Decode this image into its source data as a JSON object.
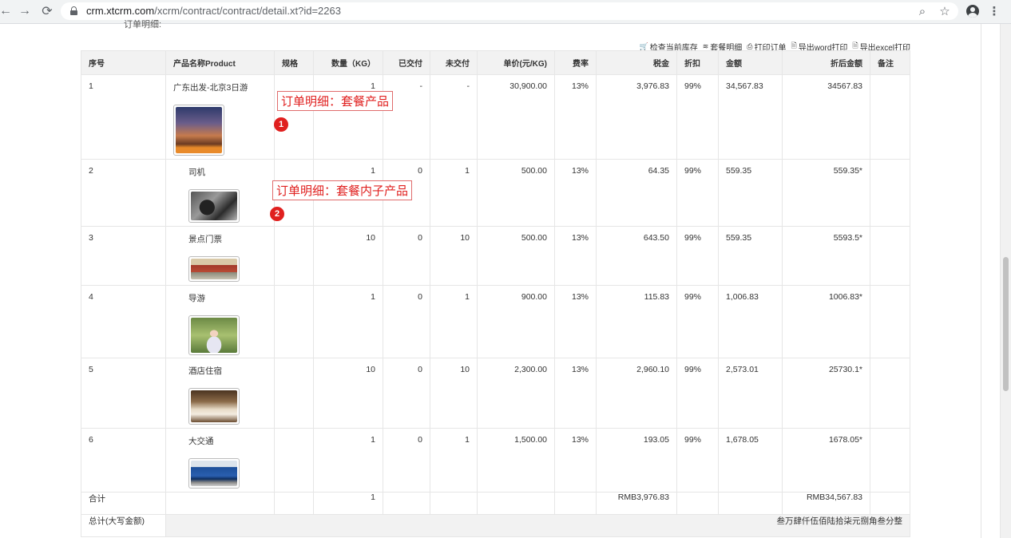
{
  "browser": {
    "url_host": "crm.xtcrm.com",
    "url_path": "/xcrm/contract/contract/detail.xt?id=2263"
  },
  "page": {
    "cut_title": "订单明细:"
  },
  "toolbar": [
    {
      "icon": "cart-icon",
      "glyph": "🛒",
      "label": "检查当前库存"
    },
    {
      "icon": "layers-icon",
      "glyph": "≋",
      "label": "套餐明细"
    },
    {
      "icon": "printer-icon",
      "glyph": "⎙",
      "label": "打印订单"
    },
    {
      "icon": "word-file-icon",
      "glyph": "🗎",
      "label": "导出word打印"
    },
    {
      "icon": "excel-file-icon",
      "glyph": "🗎",
      "label": "导出excel打印"
    }
  ],
  "table": {
    "headers": [
      "序号",
      "产品名称Product",
      "规格",
      "数量（KG）",
      "已交付",
      "未交付",
      "单价(元/KG)",
      "费率",
      "税金",
      "折扣",
      "金额",
      "折后金额",
      "备注"
    ],
    "rows": [
      {
        "no": "1",
        "product": "广东出发-北京3日游",
        "spec": "",
        "qty": "1",
        "delivered": "-",
        "undelivered": "-",
        "price": "30,900.00",
        "rate": "13%",
        "tax": "3,976.83",
        "discount": "99%",
        "amount": "34,567.83",
        "final": "34567.83",
        "note": "",
        "image": "temple",
        "sub": false
      },
      {
        "no": "2",
        "product": "司机",
        "spec": "",
        "qty": "1",
        "delivered": "0",
        "undelivered": "1",
        "price": "500.00",
        "rate": "13%",
        "tax": "64.35",
        "discount": "99%",
        "amount": "559.35",
        "final": "559.35*",
        "note": "",
        "image": "car",
        "sub": true
      },
      {
        "no": "3",
        "product": "景点门票",
        "spec": "",
        "qty": "10",
        "delivered": "0",
        "undelivered": "10",
        "price": "500.00",
        "rate": "13%",
        "tax": "643.50",
        "discount": "99%",
        "amount": "559.35",
        "final": "5593.5*",
        "note": "",
        "image": "gate",
        "sub": true
      },
      {
        "no": "4",
        "product": "导游",
        "spec": "",
        "qty": "1",
        "delivered": "0",
        "undelivered": "1",
        "price": "900.00",
        "rate": "13%",
        "tax": "115.83",
        "discount": "99%",
        "amount": "1,006.83",
        "final": "1006.83*",
        "note": "",
        "image": "guide",
        "sub": true
      },
      {
        "no": "5",
        "product": "酒店住宿",
        "spec": "",
        "qty": "10",
        "delivered": "0",
        "undelivered": "10",
        "price": "2,300.00",
        "rate": "13%",
        "tax": "2,960.10",
        "discount": "99%",
        "amount": "2,573.01",
        "final": "25730.1*",
        "note": "",
        "image": "hotel",
        "sub": true
      },
      {
        "no": "6",
        "product": "大交通",
        "spec": "",
        "qty": "1",
        "delivered": "0",
        "undelivered": "1",
        "price": "1,500.00",
        "rate": "13%",
        "tax": "193.05",
        "discount": "99%",
        "amount": "1,678.05",
        "final": "1678.05*",
        "note": "",
        "image": "bus",
        "sub": true
      }
    ],
    "total": {
      "label": "合计",
      "qty": "1",
      "tax": "RMB3,976.83",
      "final": "RMB34,567.83"
    },
    "summary": {
      "label": "总计(大写金额)",
      "value": "叁万肆仟伍佰陆拾柒元捌角叁分整"
    }
  },
  "annotations": [
    {
      "text": "订单明细：套餐产品",
      "badge": "1"
    },
    {
      "text": "订单明细：套餐内子产品",
      "badge": "2"
    }
  ]
}
